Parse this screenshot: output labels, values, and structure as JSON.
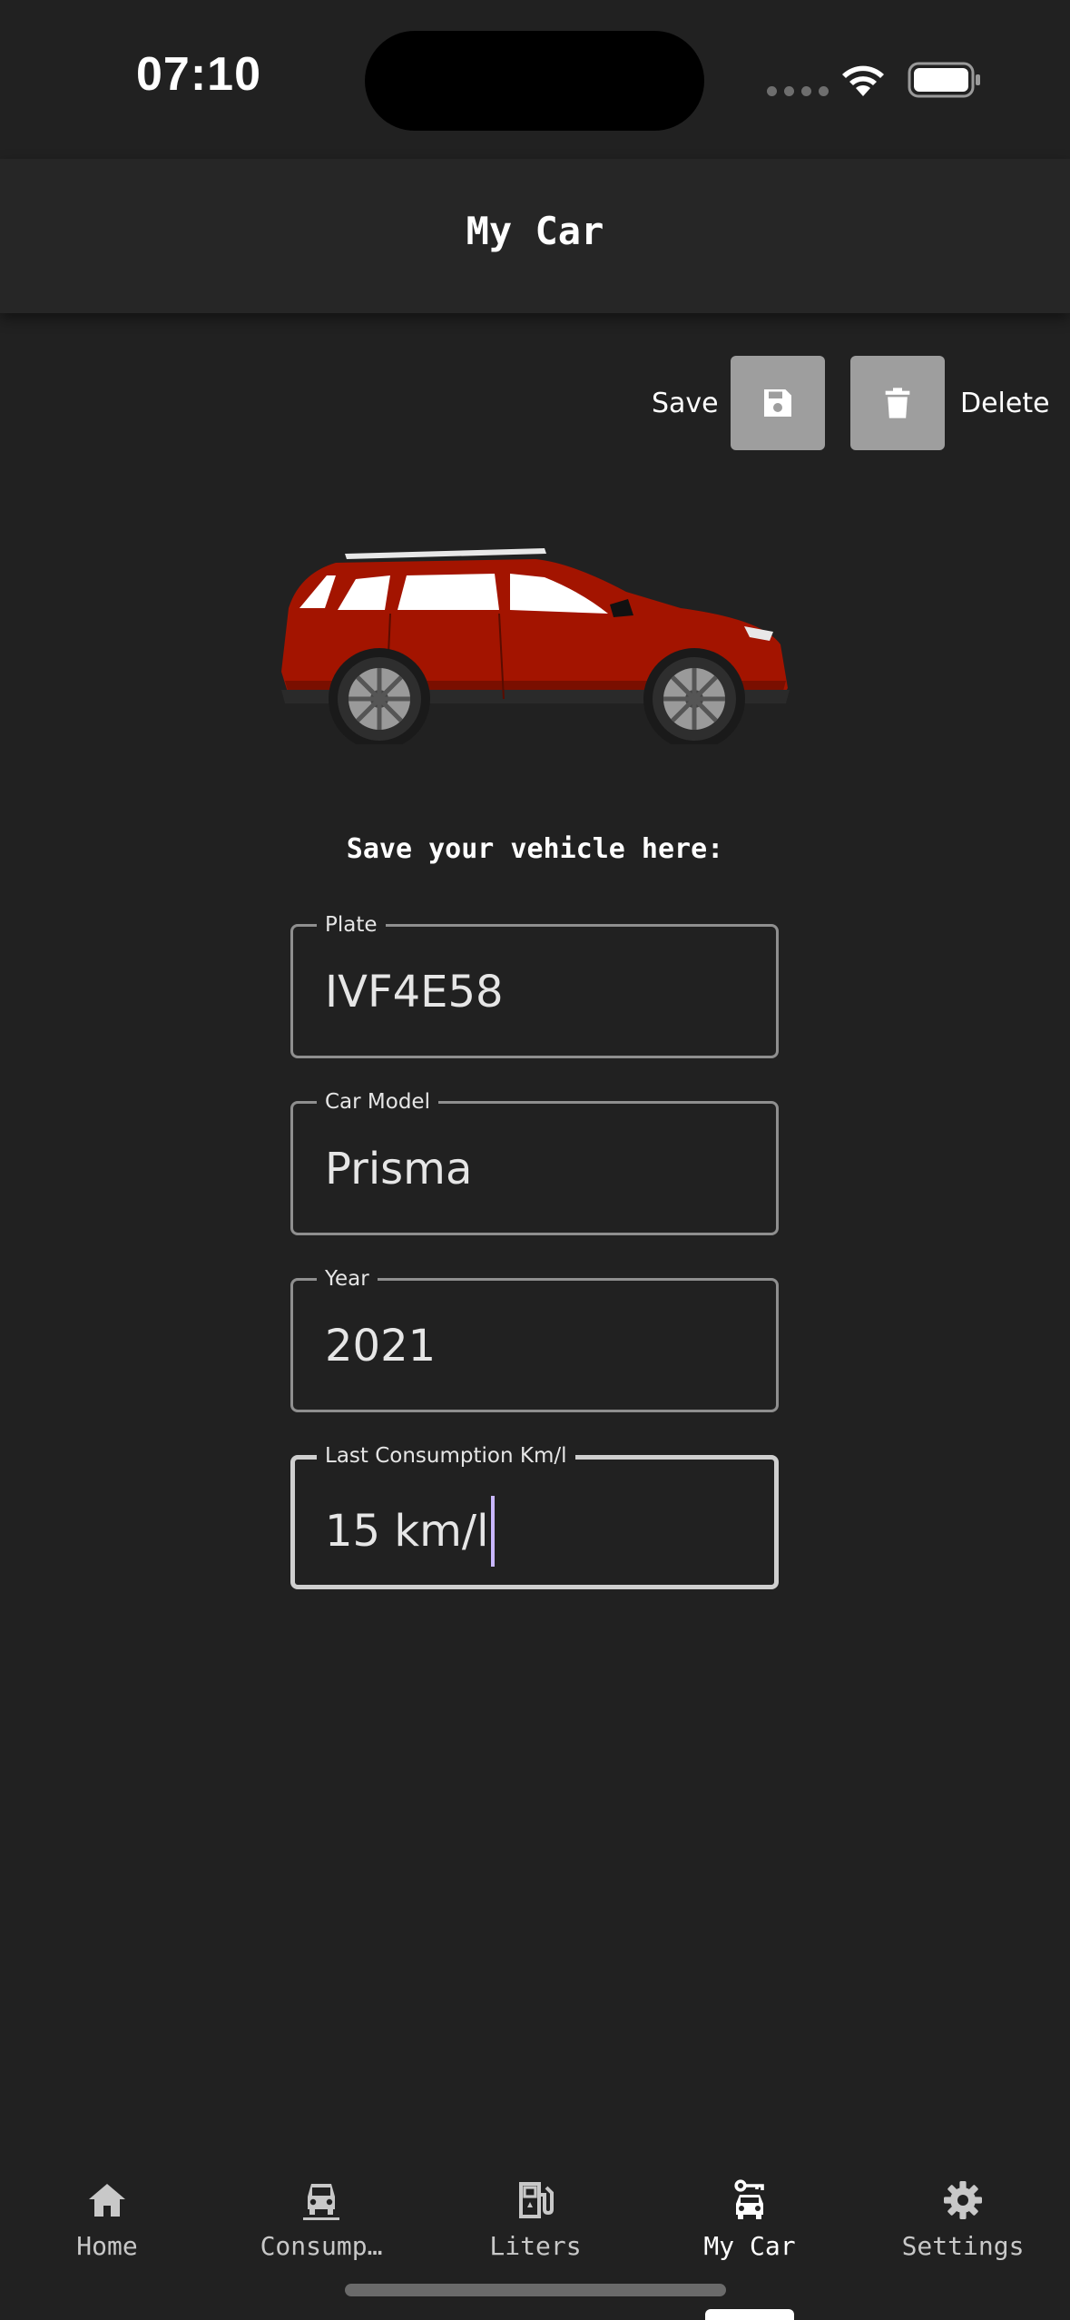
{
  "status_bar": {
    "time": "07:10"
  },
  "header": {
    "title": "My Car"
  },
  "actions": {
    "save_label": "Save",
    "delete_label": "Delete",
    "save_icon": "floppy-disk-icon",
    "delete_icon": "trash-icon"
  },
  "car_image": {
    "body_color": "#a31400"
  },
  "section_heading": "Save your vehicle here:",
  "form": {
    "plate": {
      "label": "Plate",
      "value": "IVF4E58"
    },
    "car_model": {
      "label": "Car Model",
      "value": "Prisma"
    },
    "year": {
      "label": "Year",
      "value": "2021"
    },
    "last_consumption": {
      "label": "Last Consumption Km/l",
      "value": "15 km/l",
      "focused": true
    }
  },
  "nav": {
    "active": "my_car",
    "items": [
      {
        "key": "home",
        "label": "Home",
        "icon": "home-icon"
      },
      {
        "key": "consumption",
        "label": "Consump…",
        "icon": "car-front-icon"
      },
      {
        "key": "liters",
        "label": "Liters",
        "icon": "fuel-pump-icon"
      },
      {
        "key": "my_car",
        "label": "My Car",
        "icon": "car-key-icon"
      },
      {
        "key": "settings",
        "label": "Settings",
        "icon": "gear-icon"
      }
    ]
  },
  "colors": {
    "background": "#212121",
    "header_background": "#262626",
    "button_gray": "#9e9e9e",
    "caret": "#c9b7ff"
  }
}
